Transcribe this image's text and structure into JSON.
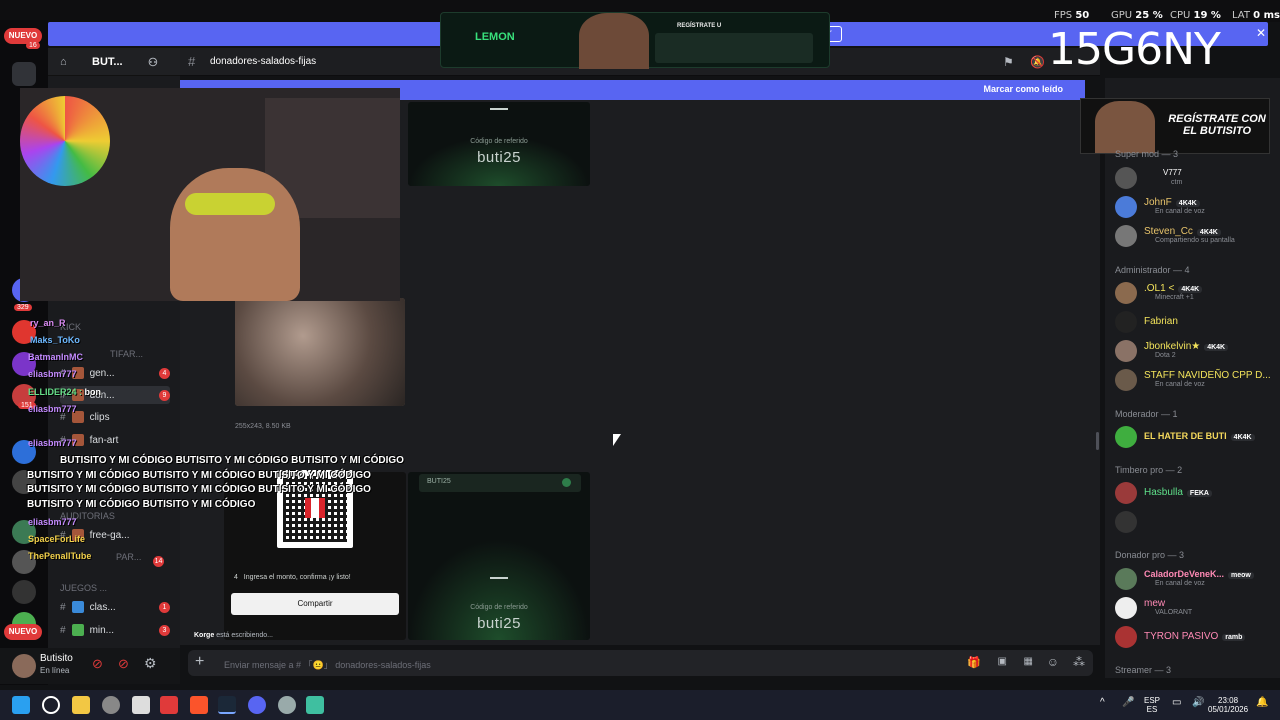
{
  "perf": {
    "fps_label": "FPS",
    "fps": "50",
    "gpu_label": "GPU",
    "gpu": "25 %",
    "cpu_label": "CPU",
    "cpu": "19 %",
    "lat_label": "LAT",
    "lat": "0 ms"
  },
  "stream_tag": "15G6NY",
  "lemon_ad": {
    "brand": "LEMON",
    "headline": "REGÍSTRATE U"
  },
  "server": {
    "name": "BUT...",
    "nuevo_top": "NUEVO",
    "nuevo_top_count": "16",
    "nuevo_bottom": "NUEVO",
    "badge_329": "329",
    "badge_151": "151"
  },
  "channels": [
    {
      "label": "gen...",
      "badge": "4"
    },
    {
      "label": "don...",
      "badge": "9"
    },
    {
      "label": "clips",
      "badge": ""
    },
    {
      "label": "fan-art",
      "badge": ""
    },
    {
      "label": "free-ga...",
      "badge": ""
    },
    {
      "label": "clas...",
      "badge": "1"
    },
    {
      "label": "min...",
      "badge": "3"
    }
  ],
  "categories": {
    "kick": "KICK",
    "notif": "TIFAR...",
    "auditorias": "AUDITORIAS",
    "juegos": "JUEGOS ...",
    "par": "PAR..."
  },
  "header": {
    "channel_title": "donadores-salados-fijas"
  },
  "blue_bar": {
    "mark_read": "Marcar como leído"
  },
  "cards": {
    "ref_label": "Código de referido",
    "ref_code": "buti25",
    "ref_code_btn": "BUTI25",
    "file_info": "255x243, 8.50 KB",
    "step_num": "4",
    "step_text": "Ingresa el monto, confirma ¡y listo!",
    "share": "Compartir"
  },
  "overlay": {
    "line1": "BUTISITO Y MI CÓDIGO BUTISITO Y MI CÓDIGO BUTISITO Y MI CÓDIGO",
    "line2": "BUTISITO Y MI CÓDIGO BUTISITO Y MI CÓDIGO BUTISITO Y MI CÓDIGO",
    "line3": "BUTISITO Y MI CÓDIGO BUTISITO Y MI CÓDIGO BUTISITO Y MI CÓDIGO",
    "line4": "BUTISITO Y MI CÓDIGO BUTISITO Y MI CÓDIGO"
  },
  "stream_chat": [
    {
      "name": "ry_an_R",
      "color": "#d98bf2"
    },
    {
      "name": "Maks_ToKo",
      "color": "#6db8ff"
    },
    {
      "name": "BatmanInMC",
      "color": "#c48bff"
    },
    {
      "name": "eliasbm777",
      "color": "#c48bff"
    },
    {
      "name": "ELLIDER24",
      "color": "#67e08a",
      "msg": "bon"
    },
    {
      "name": "eliasbm777",
      "color": "#c48bff"
    },
    {
      "name": "eliasbm777",
      "color": "#c48bff"
    },
    {
      "name": "eliasbm777",
      "color": "#c48bff"
    },
    {
      "name": "SpaceForLife",
      "color": "#f2d04b"
    },
    {
      "name": "ThePenallTube",
      "color": "#f2d04b"
    }
  ],
  "typing": {
    "user": "Korge",
    "text": "está escribiendo..."
  },
  "input": {
    "placeholder": "Enviar mensaje a # 「😐」 donadores-salados-fijas"
  },
  "user": {
    "name": "Butisito",
    "status": "En línea"
  },
  "promo": {
    "text": "REGÍSTRATE CON EL BUTISITO"
  },
  "members": {
    "groups": {
      "super_mod": "Super mod — 3",
      "admin": "Administrador — 4",
      "moderador": "Moderador — 1",
      "timbero": "Timbero pro — 2",
      "donador": "Donador pro — 3",
      "streamer": "Streamer — 3"
    },
    "list": [
      {
        "name": "V777",
        "sub": "ctm",
        "color": "#fff",
        "tag": ""
      },
      {
        "name": "JohnF",
        "sub": "En canal de voz",
        "color": "#e8c46b",
        "tag": "4K4K"
      },
      {
        "name": "Steven_Cc",
        "sub": "Compartiendo su pantalla",
        "color": "#e8c46b",
        "tag": "4K4K"
      },
      {
        "name": ".OL1 <",
        "sub": "Minecraft +1",
        "color": "#f2e35b",
        "tag": "4K4K"
      },
      {
        "name": "Fabrian",
        "sub": "",
        "color": "#f2e35b",
        "tag": ""
      },
      {
        "name": "Jbonkelvin★",
        "sub": "Dota 2",
        "color": "#f2e35b",
        "tag": "4K4K"
      },
      {
        "name": "STAFF NAVIDEÑO CPP D...",
        "sub": "En canal de voz",
        "color": "#f2e35b",
        "tag": ""
      },
      {
        "name": "EL HATER DE BUTI",
        "sub": "",
        "color": "#f5d95c",
        "tag": "4K4K"
      },
      {
        "name": "Hasbulla",
        "sub": "",
        "color": "#5fe08a",
        "tag": "FEKA"
      },
      {
        "name": "CaladorDeVeneK...",
        "sub": "En canal de voz",
        "color": "#ff8ab5",
        "tag": "meow"
      },
      {
        "name": "mew",
        "sub": "VALORANT",
        "color": "#ff8ab5",
        "tag": ""
      },
      {
        "name": "TYRON PASIVO",
        "sub": "",
        "color": "#ff8ab5",
        "tag": "ramb"
      }
    ]
  },
  "tray": {
    "lang1": "ESP",
    "lang2": "ES",
    "time": "23:08",
    "date": "05/01/2026"
  }
}
